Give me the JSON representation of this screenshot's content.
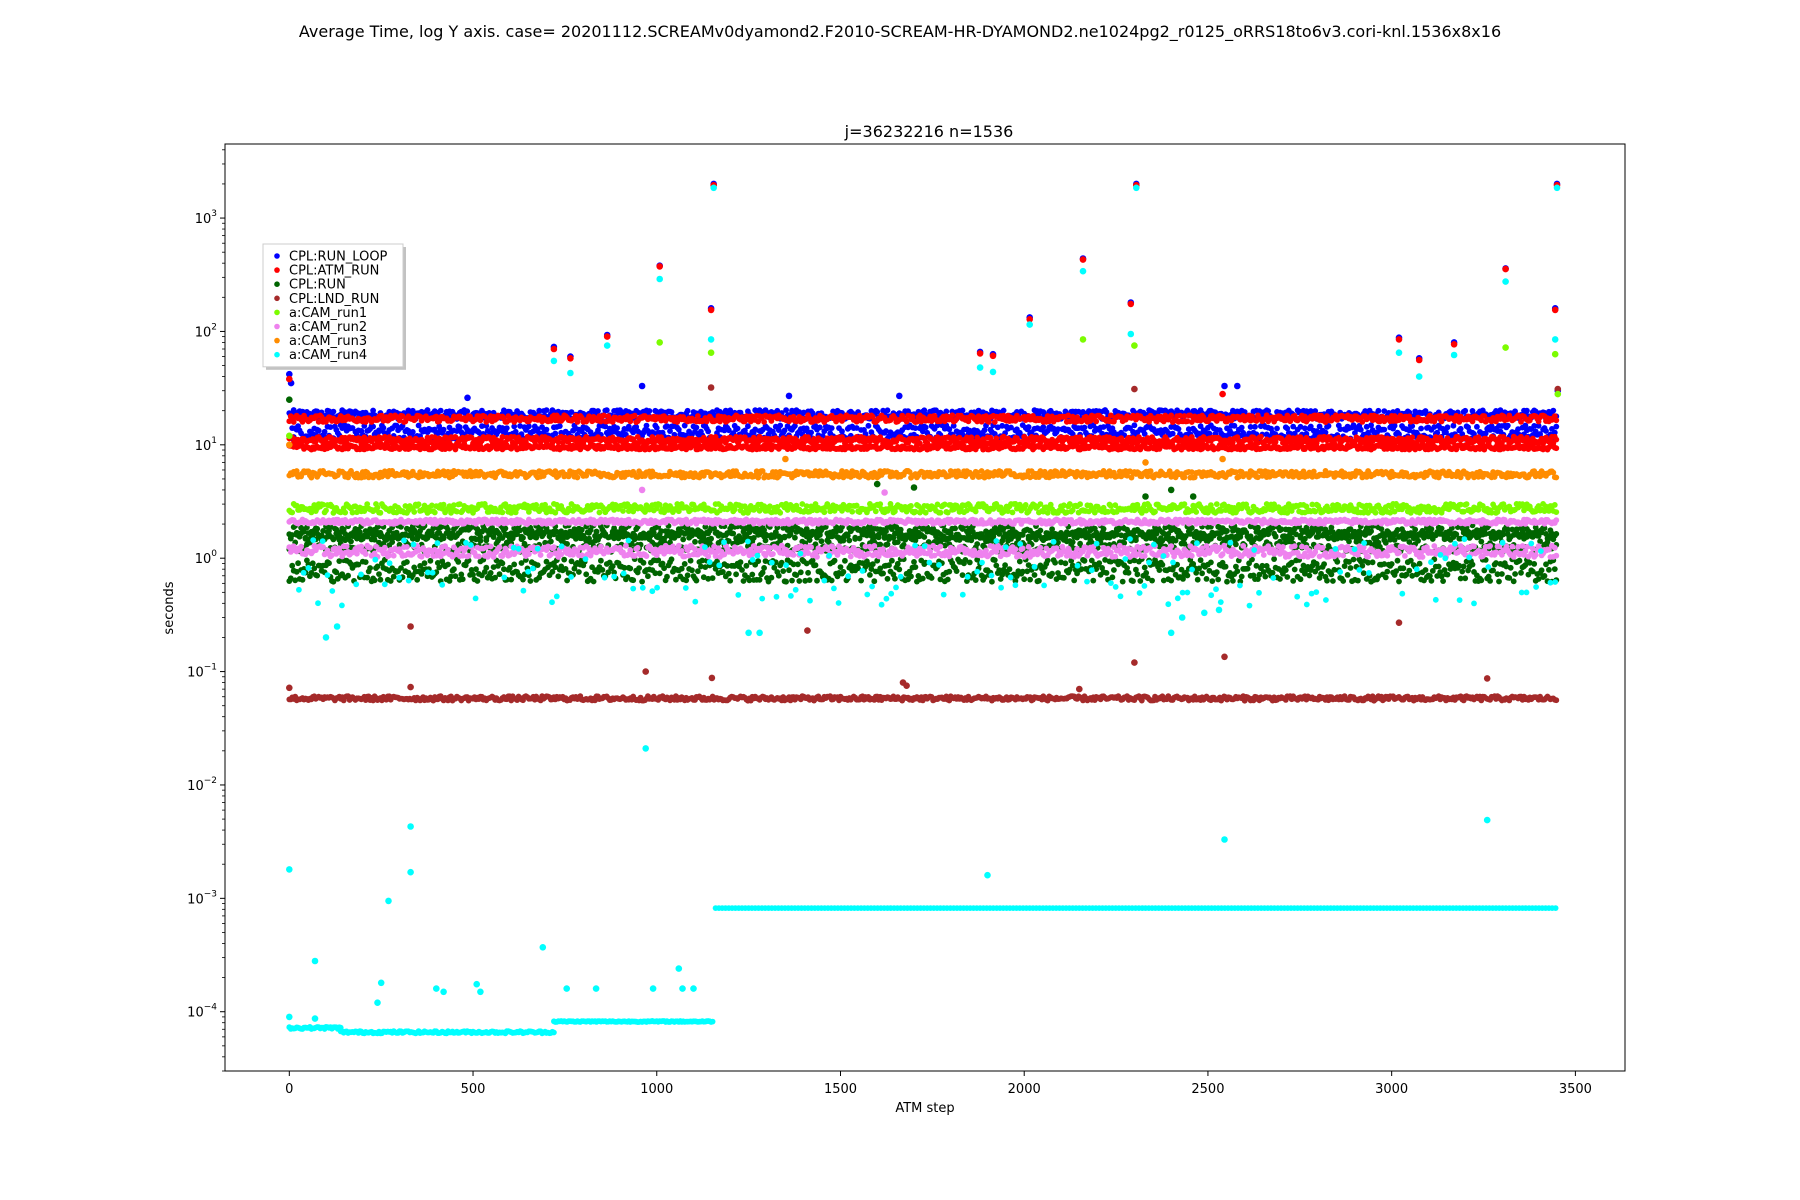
{
  "figure": {
    "suptitle": "Average Time, log Y axis.  case= 20201112.SCREAMv0dyamond2.F2010-SCREAM-HR-DYAMOND2.ne1024pg2_r0125_oRRS18to6v3.cori-knl.1536x8x16"
  },
  "chart_data": {
    "type": "scatter",
    "title": "j=36232216 n=1536",
    "xlabel": "ATM step",
    "ylabel": "seconds",
    "xlim": [
      -175,
      3635
    ],
    "ylim": [
      3e-05,
      4500
    ],
    "yscale": "log",
    "x_ticks": [
      "0",
      "500",
      "1000",
      "1500",
      "2000",
      "2500",
      "3000",
      "3500"
    ],
    "y_ticks": [
      {
        "base": "10",
        "exp": "−4",
        "value": 0.0001
      },
      {
        "base": "10",
        "exp": "−3",
        "value": 0.001
      },
      {
        "base": "10",
        "exp": "−2",
        "value": 0.01
      },
      {
        "base": "10",
        "exp": "−1",
        "value": 0.1
      },
      {
        "base": "10",
        "exp": "0",
        "value": 1
      },
      {
        "base": "10",
        "exp": "1",
        "value": 10
      },
      {
        "base": "10",
        "exp": "2",
        "value": 100
      },
      {
        "base": "10",
        "exp": "3",
        "value": 1000
      }
    ],
    "grid": false,
    "legend_position": "upper-left",
    "series": [
      {
        "name": "CPL:RUN_LOOP",
        "color": "#0000ff",
        "bands": [
          {
            "x": [
              0,
              3450
            ],
            "y": 18.5,
            "spread": 0.04
          },
          {
            "x": [
              0,
              3450
            ],
            "y": 13.0,
            "spread": 0.06
          }
        ],
        "outliers": [
          [
            0,
            42
          ],
          [
            5,
            35
          ],
          [
            720,
            73
          ],
          [
            765,
            60
          ],
          [
            865,
            93
          ],
          [
            1008,
            380
          ],
          [
            1148,
            160
          ],
          [
            1155,
            2000
          ],
          [
            1360,
            27
          ],
          [
            1880,
            66
          ],
          [
            1915,
            63
          ],
          [
            2015,
            133
          ],
          [
            2160,
            440
          ],
          [
            2290,
            180
          ],
          [
            2305,
            2000
          ],
          [
            2545,
            33
          ],
          [
            2580,
            33
          ],
          [
            3020,
            88
          ],
          [
            3075,
            58
          ],
          [
            3170,
            80
          ],
          [
            3310,
            360
          ],
          [
            3445,
            160
          ],
          [
            3450,
            2000
          ],
          [
            3452,
            30
          ],
          [
            485,
            26
          ],
          [
            960,
            33
          ],
          [
            1660,
            27
          ]
        ]
      },
      {
        "name": "CPL:ATM_RUN",
        "color": "#ff0000",
        "bands": [
          {
            "x": [
              0,
              3450
            ],
            "y": 17.0,
            "spread": 0.03
          },
          {
            "x": [
              0,
              3450
            ],
            "y": 11.0,
            "spread": 0.03
          },
          {
            "x": [
              0,
              3450
            ],
            "y": 9.5,
            "spread": 0.02
          }
        ],
        "outliers": [
          [
            0,
            38
          ],
          [
            720,
            70
          ],
          [
            765,
            58
          ],
          [
            865,
            90
          ],
          [
            1008,
            375
          ],
          [
            1148,
            155
          ],
          [
            1155,
            1950
          ],
          [
            1880,
            64
          ],
          [
            1915,
            61
          ],
          [
            2015,
            128
          ],
          [
            2160,
            430
          ],
          [
            2290,
            175
          ],
          [
            2305,
            1950
          ],
          [
            2540,
            28
          ],
          [
            3020,
            85
          ],
          [
            3075,
            56
          ],
          [
            3170,
            77
          ],
          [
            3310,
            355
          ],
          [
            3445,
            155
          ],
          [
            3450,
            1950
          ]
        ]
      },
      {
        "name": "CPL:RUN",
        "color": "#006400",
        "bands": [
          {
            "x": [
              0,
              3450
            ],
            "y": 0.78,
            "spread": 0.1
          },
          {
            "x": [
              0,
              3450
            ],
            "y": 1.4,
            "spread": 0.09
          },
          {
            "x": [
              0,
              3450
            ],
            "y": 1.7,
            "spread": 0.06
          }
        ],
        "outliers": [
          [
            0,
            25
          ],
          [
            1600,
            4.5
          ],
          [
            1700,
            4.2
          ],
          [
            2330,
            3.5
          ],
          [
            2400,
            4.0
          ],
          [
            2460,
            3.5
          ]
        ]
      },
      {
        "name": "CPL:LND_RUN",
        "color": "#a52a2a",
        "bands": [
          {
            "x": [
              0,
              3450
            ],
            "y": 0.058,
            "spread": 0.02
          }
        ],
        "outliers": [
          [
            0,
            0.072
          ],
          [
            330,
            0.25
          ],
          [
            330,
            0.073
          ],
          [
            970,
            0.1
          ],
          [
            1150,
            0.088
          ],
          [
            1410,
            0.23
          ],
          [
            1670,
            0.08
          ],
          [
            1680,
            0.075
          ],
          [
            2150,
            0.07
          ],
          [
            2300,
            0.12
          ],
          [
            2545,
            0.135
          ],
          [
            3020,
            0.27
          ],
          [
            3260,
            0.087
          ],
          [
            1148,
            32
          ],
          [
            2300,
            31
          ],
          [
            3452,
            31
          ]
        ]
      },
      {
        "name": "a:CAM_run1",
        "color": "#7cfc00",
        "bands": [
          {
            "x": [
              0,
              3450
            ],
            "y": 2.75,
            "spread": 0.04
          }
        ],
        "outliers": [
          [
            0,
            12
          ],
          [
            1008,
            80
          ],
          [
            1148,
            65
          ],
          [
            2160,
            85
          ],
          [
            2300,
            75
          ],
          [
            3310,
            72
          ],
          [
            3445,
            63
          ],
          [
            3452,
            28
          ]
        ]
      },
      {
        "name": "a:CAM_run2",
        "color": "#ee82ee",
        "bands": [
          {
            "x": [
              0,
              3450
            ],
            "y": 2.1,
            "spread": 0.02
          },
          {
            "x": [
              0,
              3450
            ],
            "y": 1.15,
            "spread": 0.05
          }
        ],
        "outliers": [
          [
            960,
            4.0
          ],
          [
            1620,
            3.8
          ]
        ]
      },
      {
        "name": "a:CAM_run3",
        "color": "#ff8c00",
        "bands": [
          {
            "x": [
              0,
              3450
            ],
            "y": 5.5,
            "spread": 0.03
          }
        ],
        "outliers": [
          [
            0,
            10
          ],
          [
            1350,
            7.5
          ],
          [
            2330,
            7.0
          ],
          [
            2540,
            7.5
          ]
        ]
      },
      {
        "name": "a:CAM_run4",
        "color": "#00ffff",
        "bands": [
          {
            "x": [
              0,
              140
            ],
            "y": 7.2e-05,
            "spread": 0.01
          },
          {
            "x": [
              140,
              720
            ],
            "y": 6.6e-05,
            "spread": 0.01
          },
          {
            "x": [
              720,
              1155
            ],
            "y": 8.2e-05,
            "spread": 0.005
          },
          {
            "x": [
              1160,
              3450
            ],
            "y": 0.00082,
            "spread": 0.0
          }
        ],
        "scatter_band": {
          "x": [
            0,
            3450
          ],
          "y": 0.75,
          "spread": 0.3
        },
        "outliers": [
          [
            0,
            0.0018
          ],
          [
            0,
            9e-05
          ],
          [
            70,
            0.00028
          ],
          [
            70,
            8.7e-05
          ],
          [
            240,
            0.00012
          ],
          [
            250,
            0.00018
          ],
          [
            270,
            0.00095
          ],
          [
            330,
            0.0043
          ],
          [
            330,
            0.0017
          ],
          [
            400,
            0.00016
          ],
          [
            420,
            0.00015
          ],
          [
            510,
            0.000175
          ],
          [
            520,
            0.00015
          ],
          [
            690,
            0.00037
          ],
          [
            755,
            0.00016
          ],
          [
            835,
            0.00016
          ],
          [
            990,
            0.00016
          ],
          [
            1060,
            0.00024
          ],
          [
            1070,
            0.00016
          ],
          [
            1100,
            0.00016
          ],
          [
            970,
            0.021
          ],
          [
            1900,
            0.0016
          ],
          [
            2545,
            0.0033
          ],
          [
            3260,
            0.0049
          ],
          [
            1008,
            290
          ],
          [
            1148,
            85
          ],
          [
            1155,
            1850
          ],
          [
            720,
            55
          ],
          [
            765,
            43
          ],
          [
            865,
            75
          ],
          [
            1880,
            48
          ],
          [
            1915,
            44
          ],
          [
            2015,
            115
          ],
          [
            2160,
            340
          ],
          [
            2290,
            95
          ],
          [
            2305,
            1850
          ],
          [
            3020,
            65
          ],
          [
            3075,
            40
          ],
          [
            3170,
            62
          ],
          [
            3310,
            275
          ],
          [
            3445,
            85
          ],
          [
            3450,
            1850
          ],
          [
            100,
            0.2
          ],
          [
            130,
            0.25
          ],
          [
            1250,
            0.22
          ],
          [
            1280,
            0.22
          ],
          [
            2400,
            0.22
          ],
          [
            2430,
            0.3
          ],
          [
            2490,
            0.33
          ],
          [
            2530,
            0.35
          ]
        ]
      }
    ]
  }
}
